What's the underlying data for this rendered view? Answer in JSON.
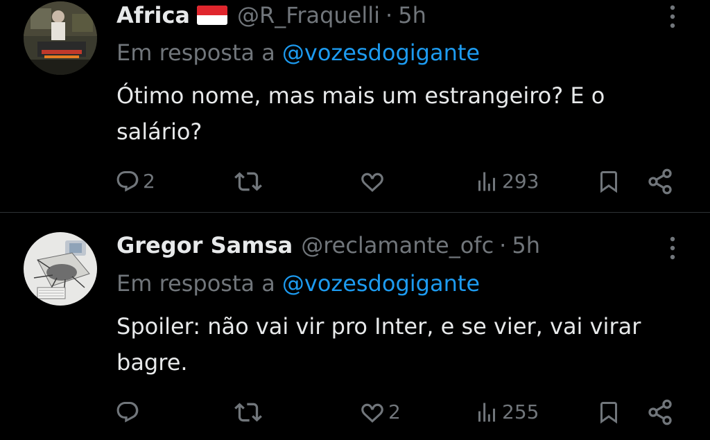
{
  "colors": {
    "background": "#000000",
    "text": "#e7e9ea",
    "muted": "#71767b",
    "link": "#1d9bf0",
    "divider": "#2f3336"
  },
  "tweets": [
    {
      "display_name": "Africa",
      "flag": "flag-indonesia-icon",
      "handle": "@R_Fraquelli",
      "separator": "·",
      "time": "5h",
      "reply_prefix": "Em resposta a",
      "reply_to": "@vozesdogigante",
      "text": "Ótimo nome, mas mais um estrangeiro? E o salário?",
      "replies": "2",
      "retweets": "",
      "likes": "",
      "views": "293"
    },
    {
      "display_name": "Gregor Samsa",
      "handle": "@reclamante_ofc",
      "separator": "·",
      "time": "5h",
      "reply_prefix": "Em resposta a",
      "reply_to": "@vozesdogigante",
      "text": "Spoiler: não vai vir pro Inter, e se vier, vai virar bagre.",
      "replies": "",
      "retweets": "",
      "likes": "2",
      "views": "255"
    }
  ]
}
